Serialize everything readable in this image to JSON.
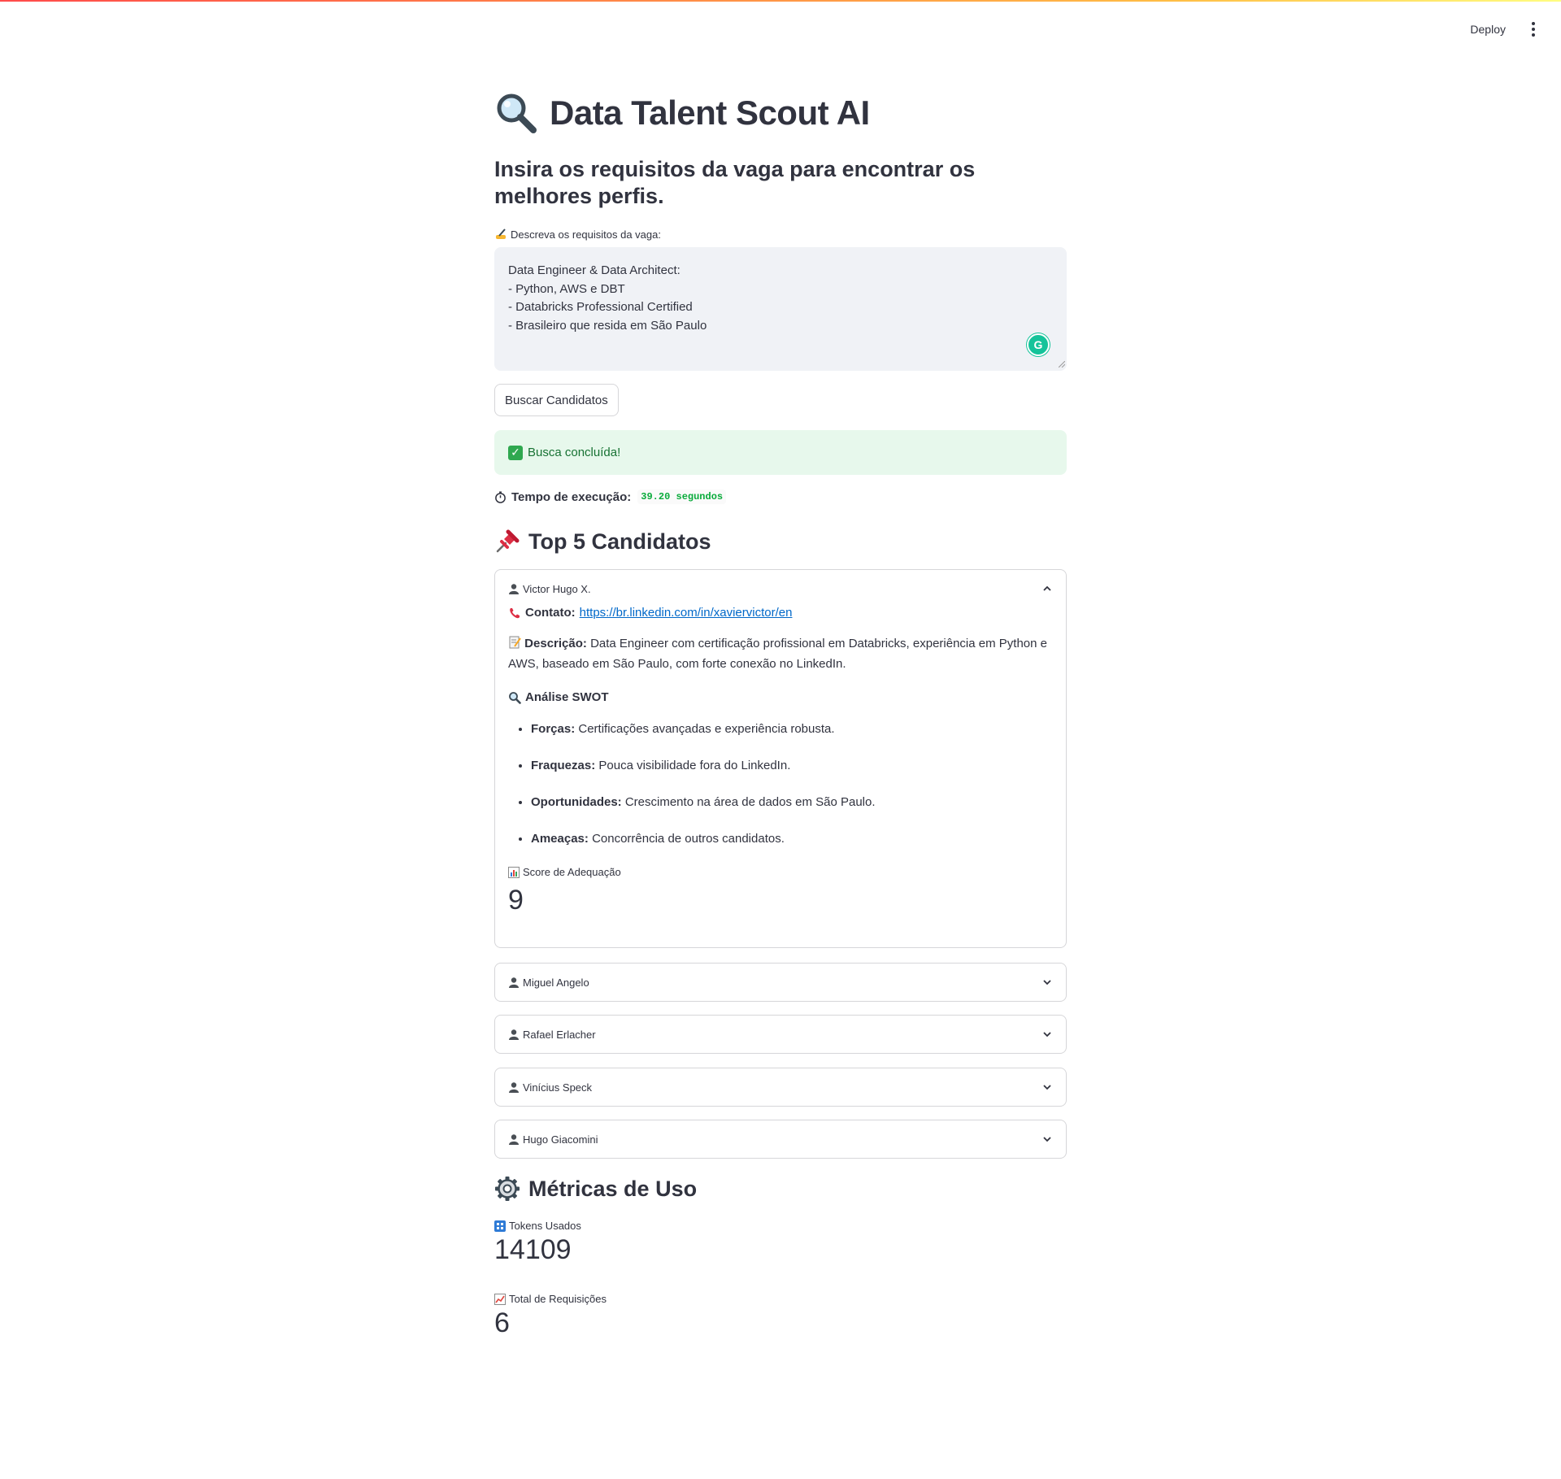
{
  "header": {
    "deploy_label": "Deploy"
  },
  "app": {
    "title": "Data Talent Scout AI",
    "subtitle": "Insira os requisitos da vaga para encontrar os melhores perfis."
  },
  "form": {
    "label": "Descreva os requisitos da vaga:",
    "textarea_value": "Data Engineer & Data Architect:\n- Python, AWS e DBT\n- Databricks Professional Certified\n- Brasileiro que resida em São Paulo",
    "search_button": "Buscar Candidatos"
  },
  "status": {
    "success_message": "Busca concluída!",
    "exec_label": "Tempo de execução:",
    "exec_value": "39.20 segundos"
  },
  "candidates_section": {
    "title": "Top 5 Candidatos",
    "expanded": {
      "name": "Victor Hugo X.",
      "contact_label": "Contato:",
      "contact_link": "https://br.linkedin.com/in/xaviervictor/en",
      "description_label": "Descrição:",
      "description": "Data Engineer com certificação profissional em Databricks, experiência em Python e AWS, baseado em São Paulo, com forte conexão no LinkedIn.",
      "swot_title": "Análise SWOT",
      "swot": [
        {
          "label": "Forças:",
          "text": "Certificações avançadas e experiência robusta."
        },
        {
          "label": "Fraquezas:",
          "text": "Pouca visibilidade fora do LinkedIn."
        },
        {
          "label": "Oportunidades:",
          "text": "Crescimento na área de dados em São Paulo."
        },
        {
          "label": "Ameaças:",
          "text": "Concorrência de outros candidatos."
        }
      ],
      "score_label": "Score de Adequação",
      "score_value": "9"
    },
    "collapsed": [
      {
        "name": "Miguel Angelo"
      },
      {
        "name": "Rafael Erlacher"
      },
      {
        "name": "Vinícius Speck"
      },
      {
        "name": "Hugo Giacomini"
      }
    ]
  },
  "metrics_section": {
    "title": "Métricas de Uso",
    "tokens_label": "Tokens Usados",
    "tokens_value": "14109",
    "requests_label": "Total de Requisições",
    "requests_value": "6"
  },
  "colors": {
    "accent_link": "#0068c9",
    "success_bg": "#e7f8ec",
    "success_text": "#177233",
    "code_green": "#09ab3b"
  },
  "icons": {
    "title": "magnifier-icon",
    "form_label": "writing-hand-icon",
    "success": "check-mark-icon",
    "exec": "stopwatch-icon",
    "candidates": "pushpin-icon",
    "person": "bust-silhouette-icon",
    "contact": "telephone-icon",
    "description": "memo-icon",
    "swot": "magnifier-icon",
    "score": "bar-chart-icon",
    "metrics": "gear-icon",
    "tokens": "input-numbers-icon",
    "requests": "chart-increasing-icon"
  }
}
